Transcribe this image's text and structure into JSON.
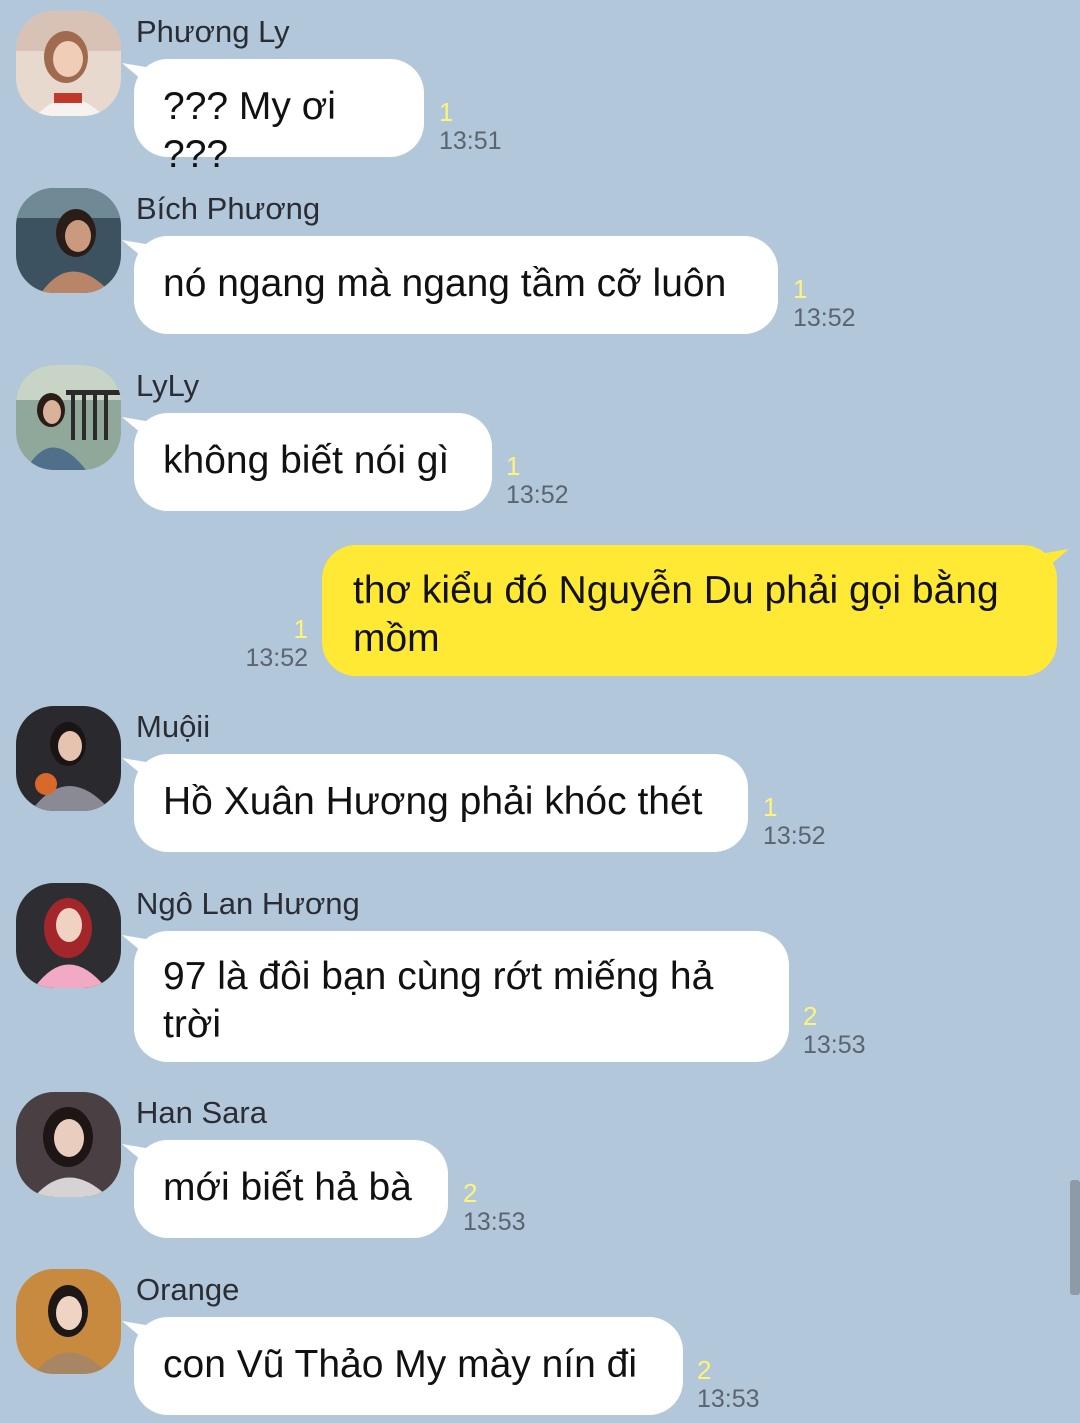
{
  "messages": [
    {
      "sender": "Phương Ly",
      "text": "??? My ơi ???",
      "unread": "1",
      "time": "13:51",
      "avatar": "avatar-phuong-ly"
    },
    {
      "sender": "Bích Phương",
      "text": "nó ngang mà ngang tầm cỡ luôn",
      "unread": "1",
      "time": "13:52",
      "avatar": "avatar-bich-phuong"
    },
    {
      "sender": "LyLy",
      "text": "không biết nói gì",
      "unread": "1",
      "time": "13:52",
      "avatar": "avatar-lyly"
    },
    {
      "sender": "",
      "text": "thơ kiểu đó Nguyễn Du phải gọi bằng\nmồm",
      "unread": "1",
      "time": "13:52",
      "outgoing": true
    },
    {
      "sender": "Muộii",
      "text": "Hồ Xuân Hương phải khóc thét",
      "unread": "1",
      "time": "13:52",
      "avatar": "avatar-muoii"
    },
    {
      "sender": "Ngô Lan Hương",
      "text": "97 là đôi bạn cùng rớt miếng hả\ntrời",
      "unread": "2",
      "time": "13:53",
      "avatar": "avatar-ngo-lan-huong"
    },
    {
      "sender": "Han Sara",
      "text": "mới biết hả bà",
      "unread": "2",
      "time": "13:53",
      "avatar": "avatar-han-sara"
    },
    {
      "sender": "Orange",
      "text": "con Vũ Thảo My mày nín đi",
      "unread": "2",
      "time": "13:53",
      "avatar": "avatar-orange"
    }
  ],
  "colors": {
    "background": "#b2c7da",
    "incoming_bubble": "#ffffff",
    "outgoing_bubble": "#ffe934",
    "unread_count": "#fff37a",
    "timestamp": "#5b6570"
  }
}
